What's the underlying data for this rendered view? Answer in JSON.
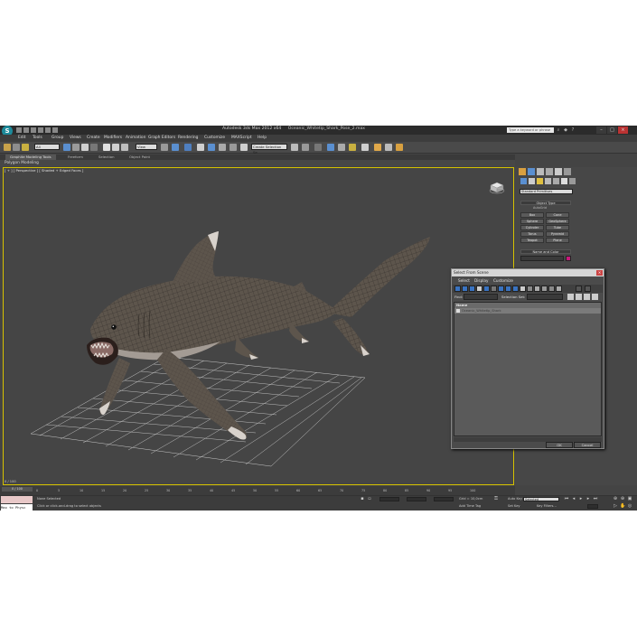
{
  "window": {
    "app_title": "Autodesk 3ds Max 2012 x64",
    "file_name": "Oceanic_Whitetip_Shark_Pose_2.max",
    "search_placeholder": "Type a keyword or phrase"
  },
  "menubar": [
    "Edit",
    "Tools",
    "Group",
    "Views",
    "Create",
    "Modifiers",
    "Animation",
    "Graph Editors",
    "Rendering",
    "Customize",
    "MAXScript",
    "Help"
  ],
  "toolbar": {
    "filter": "All",
    "ref_coord": "View",
    "named_selection": "Create Selection Se"
  },
  "ribbon": {
    "tabs": [
      "Graphite Modeling Tools",
      "Freeform",
      "Selection",
      "Object Paint"
    ],
    "sub_label": "Polygon Modeling"
  },
  "viewport": {
    "label": "[ + ] [ Perspective ] [ Shaded + Edged Faces ]",
    "frame_counter": "0 / 100"
  },
  "command_panel": {
    "category": "Standard Primitives",
    "object_type_header": "Object Type",
    "autogrid": "AutoGrid",
    "primitives": [
      "Box",
      "Cone",
      "Sphere",
      "GeoSphere",
      "Cylinder",
      "Tube",
      "Torus",
      "Pyramid",
      "Teapot",
      "Plane"
    ],
    "name_color_header": "Name and Color"
  },
  "dialog": {
    "title": "Select From Scene",
    "menu": [
      "Select",
      "Display",
      "Customize"
    ],
    "find_label": "Find:",
    "selection_set_label": "Selection Set:",
    "column_header": "Name",
    "rows": [
      "Oceanic_Whitetip_Shark"
    ],
    "ok": "OK",
    "cancel": "Cancel"
  },
  "timeline": {
    "slider": "0 / 100",
    "ticks": [
      "0",
      "5",
      "10",
      "15",
      "20",
      "25",
      "30",
      "35",
      "40",
      "45",
      "50",
      "55",
      "60",
      "65",
      "70",
      "75",
      "80",
      "85",
      "90",
      "95",
      "100"
    ]
  },
  "statusbar": {
    "maxscript_listener": "Max to Physc",
    "selection_status": "None Selected",
    "prompt": "Click or click-and-drag to select objects",
    "grid": "Grid = 10,0cm",
    "add_time_tag": "Add Time Tag",
    "auto_key": "Auto Key",
    "selected_dropdown": "Selected",
    "set_key": "Set Key",
    "key_filters": "Key Filters..."
  },
  "colors": {
    "viewport_bg": "#454545",
    "viewport_border": "#d6c200",
    "shark_body": "#5d554c",
    "shark_belly": "#b5aea8",
    "grid": "#bdbdbd",
    "dialog_selection": "#7b7b7b",
    "accent_blue": "#3a73c0"
  }
}
